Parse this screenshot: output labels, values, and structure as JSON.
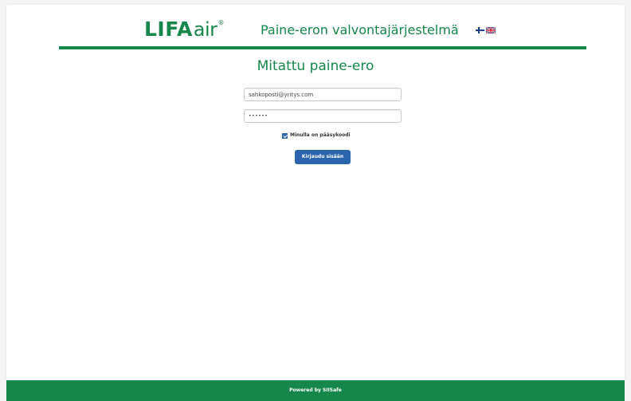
{
  "header": {
    "logo": {
      "lifa": "LIFA",
      "air": "air",
      "reg": "®"
    },
    "app_title": "Paine-eron valvontajärjestelmä",
    "languages": [
      {
        "code": "fi",
        "icon": "finnish-flag-icon"
      },
      {
        "code": "en",
        "icon": "uk-flag-icon"
      }
    ]
  },
  "main": {
    "title": "Mitattu paine-ero",
    "email_value": "sahkoposti@yritys.com",
    "password_value": "••••••",
    "main_code_label": "Minulla on pääsykoodi",
    "main_code_checked": true,
    "login_button_label": "Kirjaudu sisään"
  },
  "footer": {
    "text": "Powered by SIISafe"
  },
  "colors": {
    "brand_green": "#15874a",
    "button_blue": "#2b66ac",
    "page_background": "#f4f4f4"
  }
}
